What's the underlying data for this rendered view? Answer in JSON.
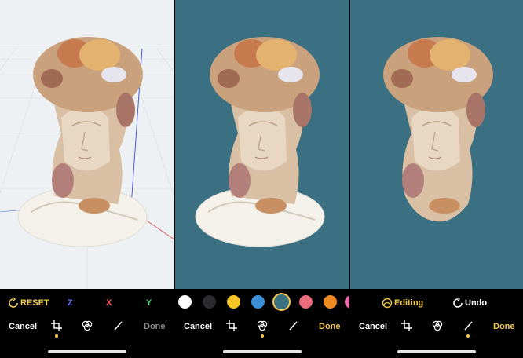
{
  "colors": {
    "accent": "#f2c94c",
    "x_axis": "#6b7cff",
    "y_axis": "#ff5a5f",
    "z_axis": "#49d37a",
    "teal_bg": "#3b6f82",
    "disabled": "#8a8a8a"
  },
  "panel1": {
    "reset_label": "RESET",
    "axes": [
      "Z",
      "X",
      "Y"
    ],
    "cancel_label": "Cancel",
    "done_label": "Done"
  },
  "panel2": {
    "swatches": [
      "#ffffff",
      "#2b2b2d",
      "#f6c424",
      "#3a8fd6",
      "#3b6f82",
      "#e96b7b",
      "#ef8a22"
    ],
    "selected_swatch_index": 4,
    "cancel_label": "Cancel",
    "done_label": "Done"
  },
  "panel3": {
    "editing_label": "Editing",
    "undo_label": "Undo",
    "cancel_label": "Cancel",
    "done_label": "Done"
  },
  "icons": {
    "reset": "rotate-icon",
    "editing": "editing-icon",
    "undo": "undo-icon",
    "crop": "crop-icon",
    "adjust": "color-circles-icon",
    "brush": "brush-icon"
  }
}
